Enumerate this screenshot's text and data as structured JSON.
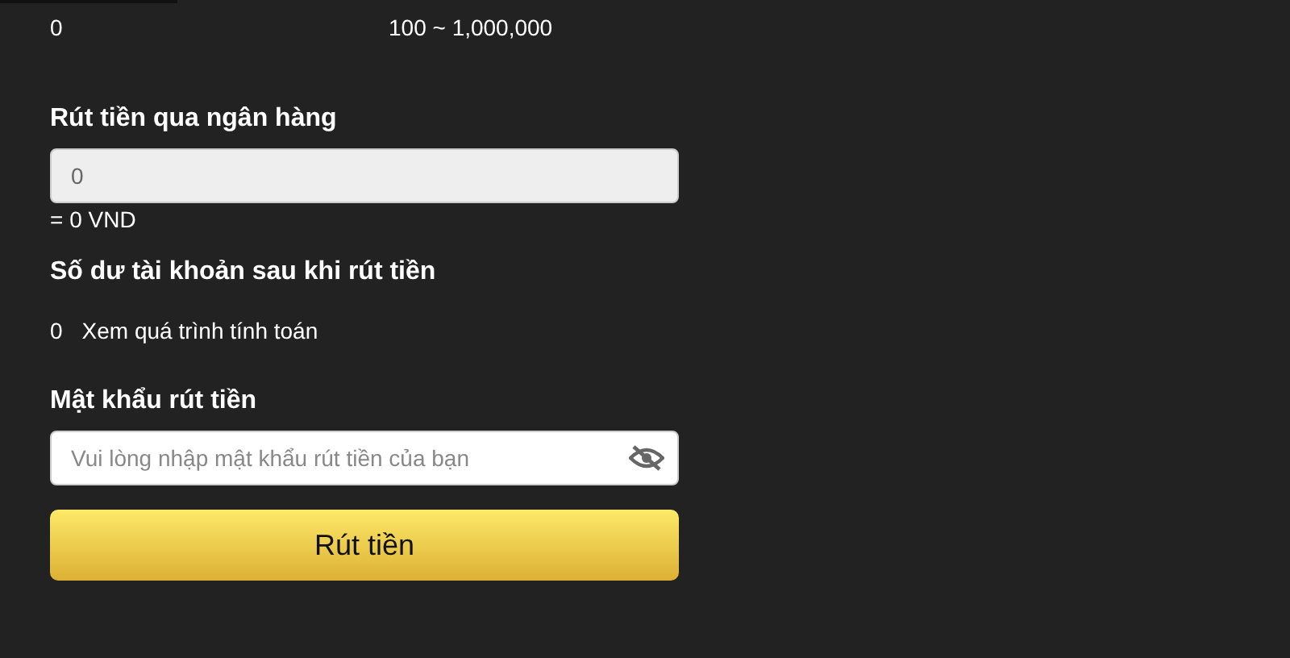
{
  "range_row": {
    "current": "0",
    "limits": "100 ~ 1,000,000"
  },
  "bank_withdrawal": {
    "label": "Rút tiền qua ngân hàng",
    "value": "0",
    "converted": "= 0 VND"
  },
  "balance_after": {
    "label": "Số dư tài khoản sau khi rút tiền",
    "amount": "0",
    "link": "Xem quá trình tính toán"
  },
  "password": {
    "label": "Mật khẩu rút tiền",
    "placeholder": "Vui lòng nhập mật khẩu rút tiền của bạn"
  },
  "submit": "Rút tiền"
}
